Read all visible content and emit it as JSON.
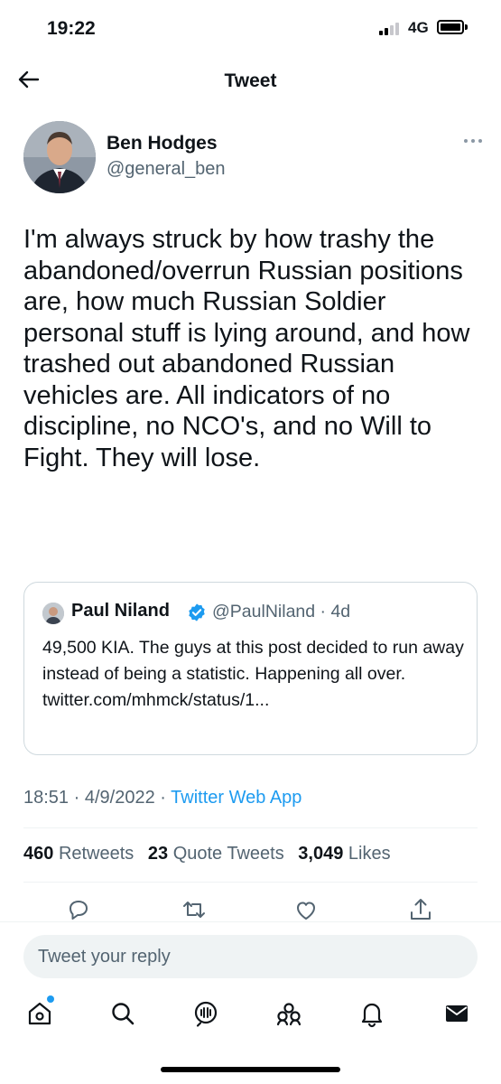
{
  "status_bar": {
    "time": "19:22",
    "network": "4G",
    "icons": [
      "signal-icon",
      "battery-icon"
    ]
  },
  "header": {
    "title": "Tweet",
    "back_icon": "arrow-left-icon"
  },
  "tweet": {
    "author_name": "Ben Hodges",
    "author_handle": "@general_ben",
    "more_icon": "more-horizontal-icon",
    "text": "I'm always struck by how trashy the abandoned/overrun Russian positions are, how much Russian Soldier personal stuff is lying around, and how trashed out abandoned Russian vehicles are. All indicators of no discipline, no NCO's, and no Will to Fight.  They will lose.",
    "quoted": {
      "author_name": "Paul Niland",
      "verified_icon": "verified-badge-icon",
      "author_handle": "@PaulNiland",
      "separator": "·",
      "age": "4d",
      "text": "49,500 KIA. The guys at this post decided to run away instead of being a statistic. Happening all over. twitter.com/mhmck/status/1..."
    },
    "time": "18:51",
    "date": "4/9/2022",
    "separator": "·",
    "source_app": "Twitter Web App",
    "stats": {
      "retweets_count": "460",
      "retweets_label": "Retweets",
      "quotes_count": "23",
      "quotes_label": "Quote Tweets",
      "likes_count": "3,049",
      "likes_label": "Likes"
    },
    "actions": [
      "reply-icon",
      "retweet-icon",
      "like-icon",
      "share-icon"
    ]
  },
  "reply": {
    "placeholder": "Tweet your reply"
  },
  "bottom_nav": {
    "items": [
      "home-icon",
      "search-icon",
      "spaces-icon",
      "communities-icon",
      "notifications-icon",
      "messages-icon"
    ]
  },
  "colors": {
    "accent": "#1d9bf0",
    "text_primary": "#0f1419",
    "text_secondary": "#536471",
    "border": "#cfd9de"
  }
}
